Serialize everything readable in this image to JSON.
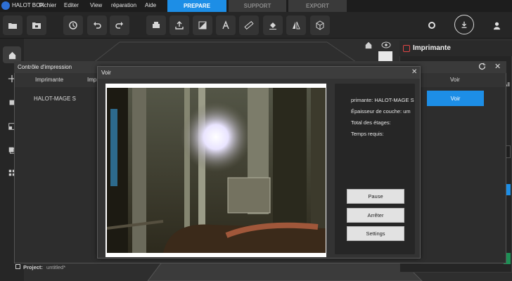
{
  "app": {
    "name": "HALOT BOX"
  },
  "menu": [
    "Fichier",
    "Editer",
    "View",
    "réparation",
    "Aide"
  ],
  "tabs": [
    {
      "label": "PREPARE",
      "active": true
    },
    {
      "label": "SUPPORT",
      "active": false
    },
    {
      "label": "EXPORT",
      "active": false
    }
  ],
  "toolbar_icons": [
    "folder-open-icon",
    "folder-save-icon",
    "history-icon",
    "undo-icon",
    "redo-icon",
    "print-icon",
    "export-icon",
    "slice-icon",
    "text-icon",
    "measure-icon",
    "paint-bucket-icon",
    "mirror-icon",
    "cube-icon"
  ],
  "right_panel": {
    "title": "Imprimante"
  },
  "controle": {
    "title": "Contrôle d'impression",
    "columns": [
      "Imprimante",
      "Impri",
      "Voir"
    ],
    "rows": [
      {
        "printer": "HALOT-MAGE S",
        "action": "Voir"
      }
    ]
  },
  "voir": {
    "title": "Voir",
    "info": {
      "printer": "primante: HALOT-MAGE S",
      "layer_thickness": "Épaisseur de couche: um",
      "total_layers": "Total des étages:",
      "time_required": "Temps requis:"
    },
    "buttons": {
      "pause": "Pause",
      "stop": "Arrêter",
      "settings": "Settings"
    }
  },
  "project": {
    "label": "Project:",
    "name": "untitled*"
  },
  "right_fragment": {
    "all": "All"
  },
  "colors": {
    "accent": "#1d8ee6",
    "danger": "#e04545"
  }
}
